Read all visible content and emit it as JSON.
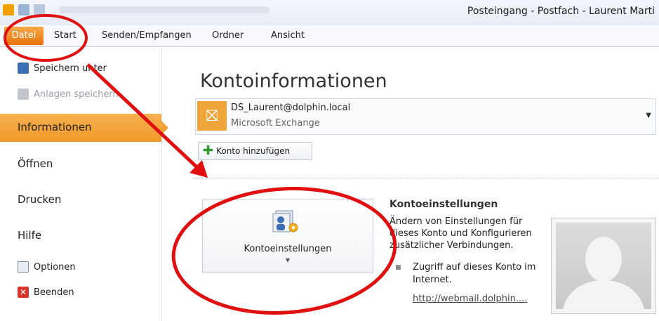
{
  "titlebar": {
    "title": "Posteingang - Postfach - Laurent Marti"
  },
  "tabs": [
    {
      "label": "Datei"
    },
    {
      "label": "Start"
    },
    {
      "label": "Senden/Empfangen"
    },
    {
      "label": "Ordner"
    },
    {
      "label": "Ansicht"
    }
  ],
  "sidebar": {
    "save_as": "Speichern unter",
    "save_attachments": "Anlagen speichern",
    "items": [
      "Informationen",
      "Öffnen",
      "Drucken",
      "Hilfe"
    ],
    "options": "Optionen",
    "exit": "Beenden"
  },
  "main": {
    "title": "Kontoinformationen",
    "account": {
      "email": "DS_Laurent@dolphin.local",
      "type": "Microsoft Exchange"
    },
    "add_account": "Konto hinzufügen",
    "settings_button": "Kontoeinstellungen",
    "settings_heading": "Kontoeinstellungen",
    "settings_desc": "Ändern von Einstellungen für dieses Konto und Konfigurieren zusätzlicher Verbindungen.",
    "bullet_text": "Zugriff auf dieses Konto im Internet.",
    "link": "http://webmail.dolphin...."
  },
  "colors": {
    "accent": "#e8720c",
    "annotation": "#e01010"
  }
}
